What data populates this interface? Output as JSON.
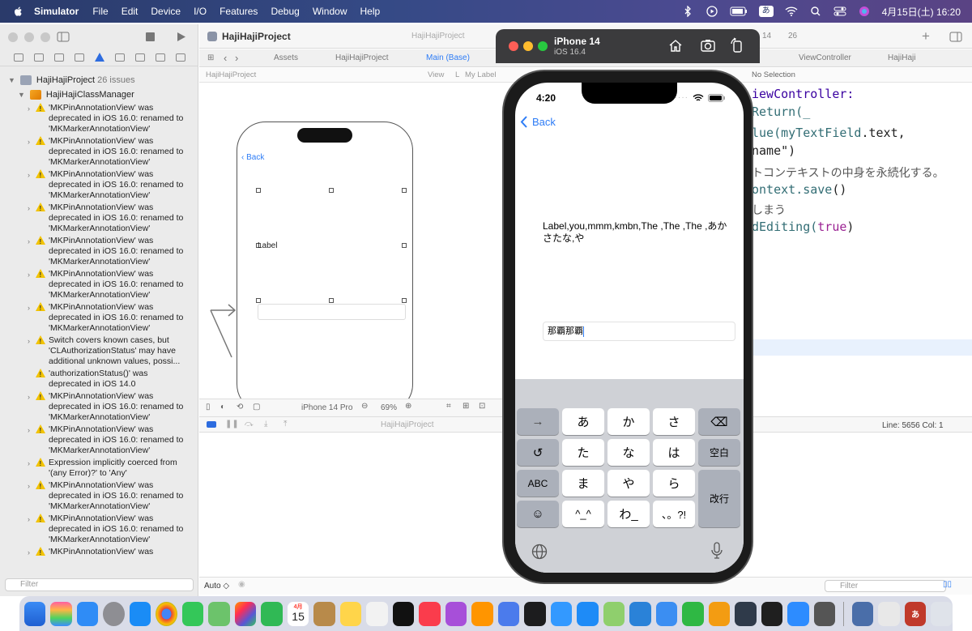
{
  "menubar": {
    "app_name": "Simulator",
    "items": [
      "File",
      "Edit",
      "Device",
      "I/O",
      "Features",
      "Debug",
      "Window",
      "Help"
    ],
    "ime": "あ",
    "clock": "4月15日(土)  16:20"
  },
  "xcode": {
    "project_title": "HajiHajiProject",
    "scheme_crumb": "HajiHajiProject",
    "issue_count_badge": "26",
    "warning_count": "14",
    "tabs": [
      "Assets",
      "HajiHajiProject",
      "Main (Base)"
    ],
    "right_tabs": [
      "ViewController",
      "HajiHaji"
    ],
    "jumpbar": [
      "HajiHajiProject",
      "View",
      "L",
      "My Label"
    ],
    "no_selection": "No Selection",
    "navigator": {
      "project": "HajiHajiProject",
      "project_issues": "26 issues",
      "group": "HajiHajiClassManager",
      "issues": [
        "'MKPinAnnotationView' was deprecated in iOS 16.0: renamed to 'MKMarkerAnnotationView'",
        "'MKPinAnnotationView' was deprecated in iOS 16.0: renamed to 'MKMarkerAnnotationView'",
        "'MKPinAnnotationView' was deprecated in iOS 16.0: renamed to 'MKMarkerAnnotationView'",
        "'MKPinAnnotationView' was deprecated in iOS 16.0: renamed to 'MKMarkerAnnotationView'",
        "'MKPinAnnotationView' was deprecated in iOS 16.0: renamed to 'MKMarkerAnnotationView'",
        "'MKPinAnnotationView' was deprecated in iOS 16.0: renamed to 'MKMarkerAnnotationView'",
        "'MKPinAnnotationView' was deprecated in iOS 16.0: renamed to 'MKMarkerAnnotationView'",
        "Switch covers known cases, but 'CLAuthorizationStatus' may have additional unknown values, possi...",
        "'authorizationStatus()' was deprecated in iOS 14.0",
        "'MKPinAnnotationView' was deprecated in iOS 16.0: renamed to 'MKMarkerAnnotationView'",
        "'MKPinAnnotationView' was deprecated in iOS 16.0: renamed to 'MKMarkerAnnotationView'",
        "Expression implicitly coerced from '(any Error)?' to 'Any'",
        "'MKPinAnnotationView' was deprecated in iOS 16.0: renamed to 'MKMarkerAnnotationView'",
        "'MKPinAnnotationView' was deprecated in iOS 16.0: renamed to 'MKMarkerAnnotationView'",
        "'MKPinAnnotationView' was"
      ],
      "filter_placeholder": "Filter"
    },
    "storyboard": {
      "back": "Back",
      "label": "Label",
      "device": "iPhone 14 Pro",
      "zoom": "69%"
    },
    "debug_crumb": "HajiHajiProject",
    "code": {
      "l1": "iewController:",
      "l2": "Return(_",
      "l3a": "lue(",
      "l3b": "myTextField",
      "l3c": ".text,",
      "l4": "name\")",
      "l5": "トコンテキストの中身を永続化する。",
      "l6a": "ontext",
      "l6b": ".save",
      "l6c": "()",
      "l7": "しまう",
      "l8a": "dEditing(",
      "l8b": "true",
      "l8c": ")"
    },
    "bottom": {
      "auto": "Auto ◇",
      "filter_placeholder": "Filter",
      "line_col": "Line: 5656  Col: 1",
      "filter2_placeholder": "Filter"
    }
  },
  "simulator": {
    "title": "iPhone 14",
    "subtitle": "iOS 16.4",
    "time": "4:20",
    "back": "Back",
    "label_text": "Label,you,mmm,kmbn,The ,The ,The ,あかさたな,や",
    "textfield_value": "那覇那覇",
    "keyboard": {
      "row1": [
        "→",
        "あ",
        "か",
        "さ",
        "⌫"
      ],
      "row2": [
        "↺",
        "た",
        "な",
        "は",
        "空白"
      ],
      "row3": [
        "ABC",
        "ま",
        "や",
        "ら",
        "改行"
      ],
      "row4": [
        "☺",
        "^_^",
        "わ_",
        "、。?!"
      ]
    }
  },
  "dock": {
    "calendar_month": "4月",
    "calendar_day": "15",
    "ime": "あ"
  },
  "colors": {
    "accent": "#2d7cf6",
    "warning": "#f2c300"
  }
}
